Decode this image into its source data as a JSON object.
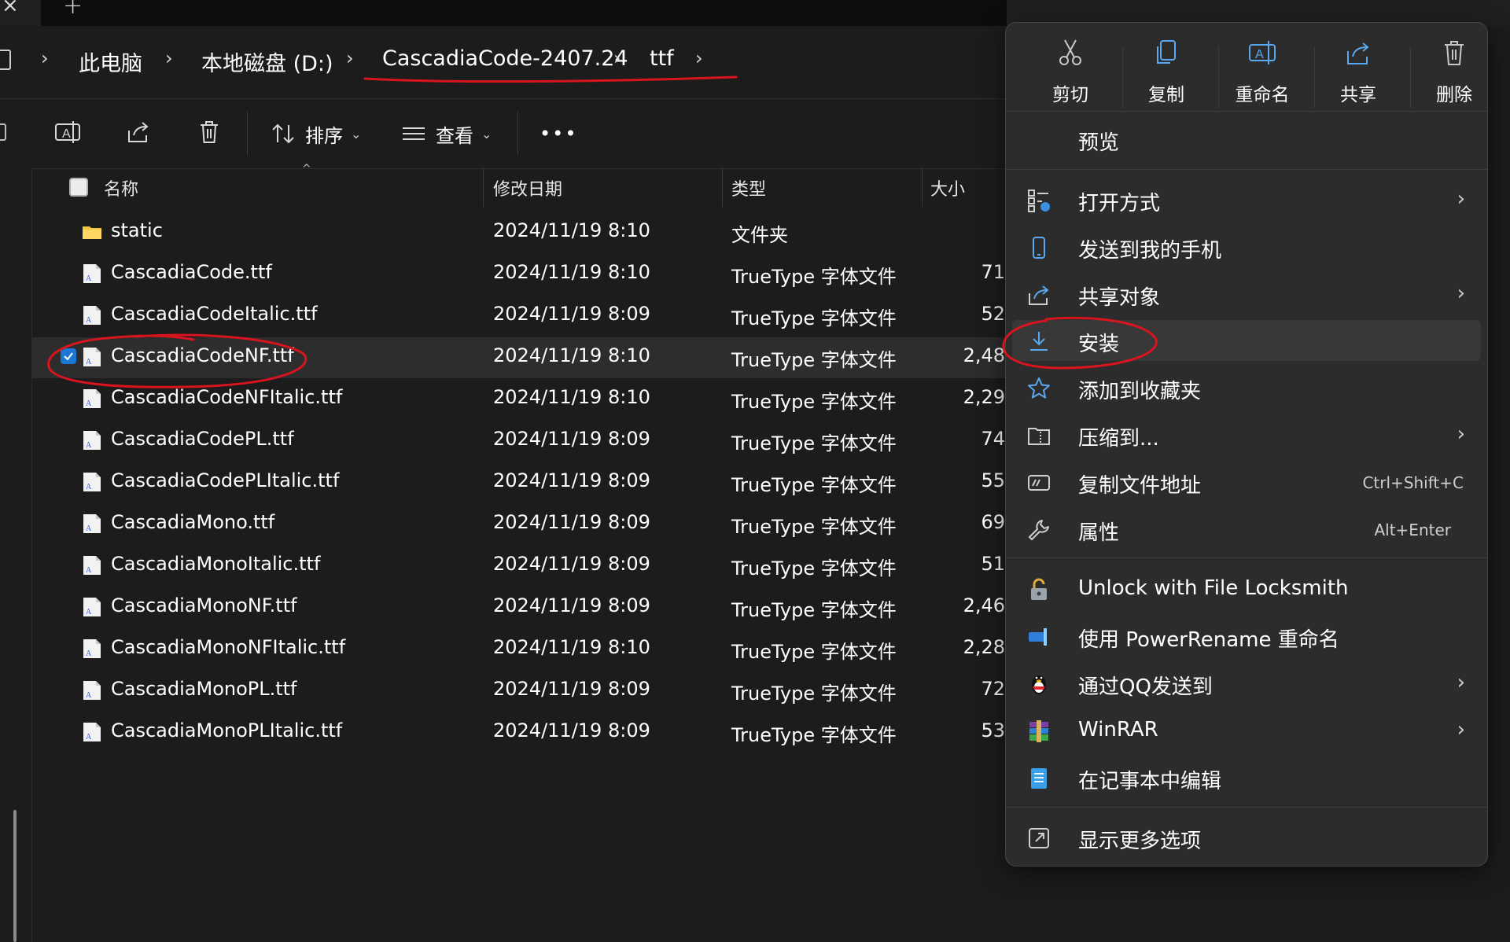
{
  "address": {
    "crumbs": [
      "此电脑",
      "本地磁盘 (D:)",
      "CascadiaCode-2407.24",
      "ttf"
    ],
    "separator": "›"
  },
  "toolbar": {
    "sort_label": "排序",
    "view_label": "查看",
    "more_label": "•••"
  },
  "columns": {
    "name": "名称",
    "date": "修改日期",
    "type": "类型",
    "size": "大小"
  },
  "files": [
    {
      "name": "static",
      "date": "2024/11/19 8:10",
      "type": "文件夹",
      "size": "",
      "kind": "folder"
    },
    {
      "name": "CascadiaCode.ttf",
      "date": "2024/11/19 8:10",
      "type": "TrueType 字体文件",
      "size": "71",
      "kind": "font"
    },
    {
      "name": "CascadiaCodeItalic.ttf",
      "date": "2024/11/19 8:09",
      "type": "TrueType 字体文件",
      "size": "52",
      "kind": "font"
    },
    {
      "name": "CascadiaCodeNF.ttf",
      "date": "2024/11/19 8:10",
      "type": "TrueType 字体文件",
      "size": "2,48",
      "kind": "font",
      "selected": true
    },
    {
      "name": "CascadiaCodeNFItalic.ttf",
      "date": "2024/11/19 8:10",
      "type": "TrueType 字体文件",
      "size": "2,29",
      "kind": "font"
    },
    {
      "name": "CascadiaCodePL.ttf",
      "date": "2024/11/19 8:09",
      "type": "TrueType 字体文件",
      "size": "74",
      "kind": "font"
    },
    {
      "name": "CascadiaCodePLItalic.ttf",
      "date": "2024/11/19 8:09",
      "type": "TrueType 字体文件",
      "size": "55",
      "kind": "font"
    },
    {
      "name": "CascadiaMono.ttf",
      "date": "2024/11/19 8:09",
      "type": "TrueType 字体文件",
      "size": "69",
      "kind": "font"
    },
    {
      "name": "CascadiaMonoItalic.ttf",
      "date": "2024/11/19 8:09",
      "type": "TrueType 字体文件",
      "size": "51",
      "kind": "font"
    },
    {
      "name": "CascadiaMonoNF.ttf",
      "date": "2024/11/19 8:09",
      "type": "TrueType 字体文件",
      "size": "2,46",
      "kind": "font"
    },
    {
      "name": "CascadiaMonoNFItalic.ttf",
      "date": "2024/11/19 8:10",
      "type": "TrueType 字体文件",
      "size": "2,28",
      "kind": "font"
    },
    {
      "name": "CascadiaMonoPL.ttf",
      "date": "2024/11/19 8:09",
      "type": "TrueType 字体文件",
      "size": "72",
      "kind": "font"
    },
    {
      "name": "CascadiaMonoPLItalic.ttf",
      "date": "2024/11/19 8:09",
      "type": "TrueType 字体文件",
      "size": "53",
      "kind": "font"
    }
  ],
  "context_menu": {
    "quick_actions": [
      {
        "label": "剪切",
        "icon": "cut-icon"
      },
      {
        "label": "复制",
        "icon": "copy-icon"
      },
      {
        "label": "重命名",
        "icon": "rename-icon"
      },
      {
        "label": "共享",
        "icon": "share-icon"
      },
      {
        "label": "删除",
        "icon": "delete-icon"
      }
    ],
    "items": [
      {
        "label": "预览",
        "icon": "",
        "shortcut": "",
        "submenu": false
      },
      {
        "label": "打开方式",
        "icon": "open-with-icon",
        "shortcut": "",
        "submenu": true
      },
      {
        "label": "发送到我的手机",
        "icon": "phone-icon",
        "shortcut": "",
        "submenu": false
      },
      {
        "label": "共享对象",
        "icon": "share-icon",
        "shortcut": "",
        "submenu": true
      },
      {
        "label": "安装",
        "icon": "install-download-icon",
        "shortcut": "",
        "submenu": false,
        "hovered": true
      },
      {
        "label": "添加到收藏夹",
        "icon": "star-icon",
        "shortcut": "",
        "submenu": false
      },
      {
        "label": "压缩到...",
        "icon": "compress-icon",
        "shortcut": "",
        "submenu": true
      },
      {
        "label": "复制文件地址",
        "icon": "copy-path-icon",
        "shortcut": "Ctrl+Shift+C",
        "submenu": false
      },
      {
        "label": "属性",
        "icon": "wrench-icon",
        "shortcut": "Alt+Enter",
        "submenu": false
      },
      {
        "label": "Unlock with File Locksmith",
        "icon": "lock-icon",
        "shortcut": "",
        "submenu": false
      },
      {
        "label": "使用 PowerRename 重命名",
        "icon": "powerrename-icon",
        "shortcut": "",
        "submenu": false
      },
      {
        "label": "通过QQ发送到",
        "icon": "qq-penguin-icon",
        "shortcut": "",
        "submenu": true
      },
      {
        "label": "WinRAR",
        "icon": "winrar-icon",
        "shortcut": "",
        "submenu": true
      },
      {
        "label": "在记事本中编辑",
        "icon": "notepad-icon",
        "shortcut": "",
        "submenu": false
      },
      {
        "label": "显示更多选项",
        "icon": "more-options-icon",
        "shortcut": "",
        "submenu": false
      }
    ]
  },
  "colors": {
    "background": "#1c1c1c",
    "menu_background": "#2c2c2c",
    "accent_blue": "#1a78d4",
    "annotation_red": "#d8141f",
    "folder_yellow": "#f5c542"
  }
}
